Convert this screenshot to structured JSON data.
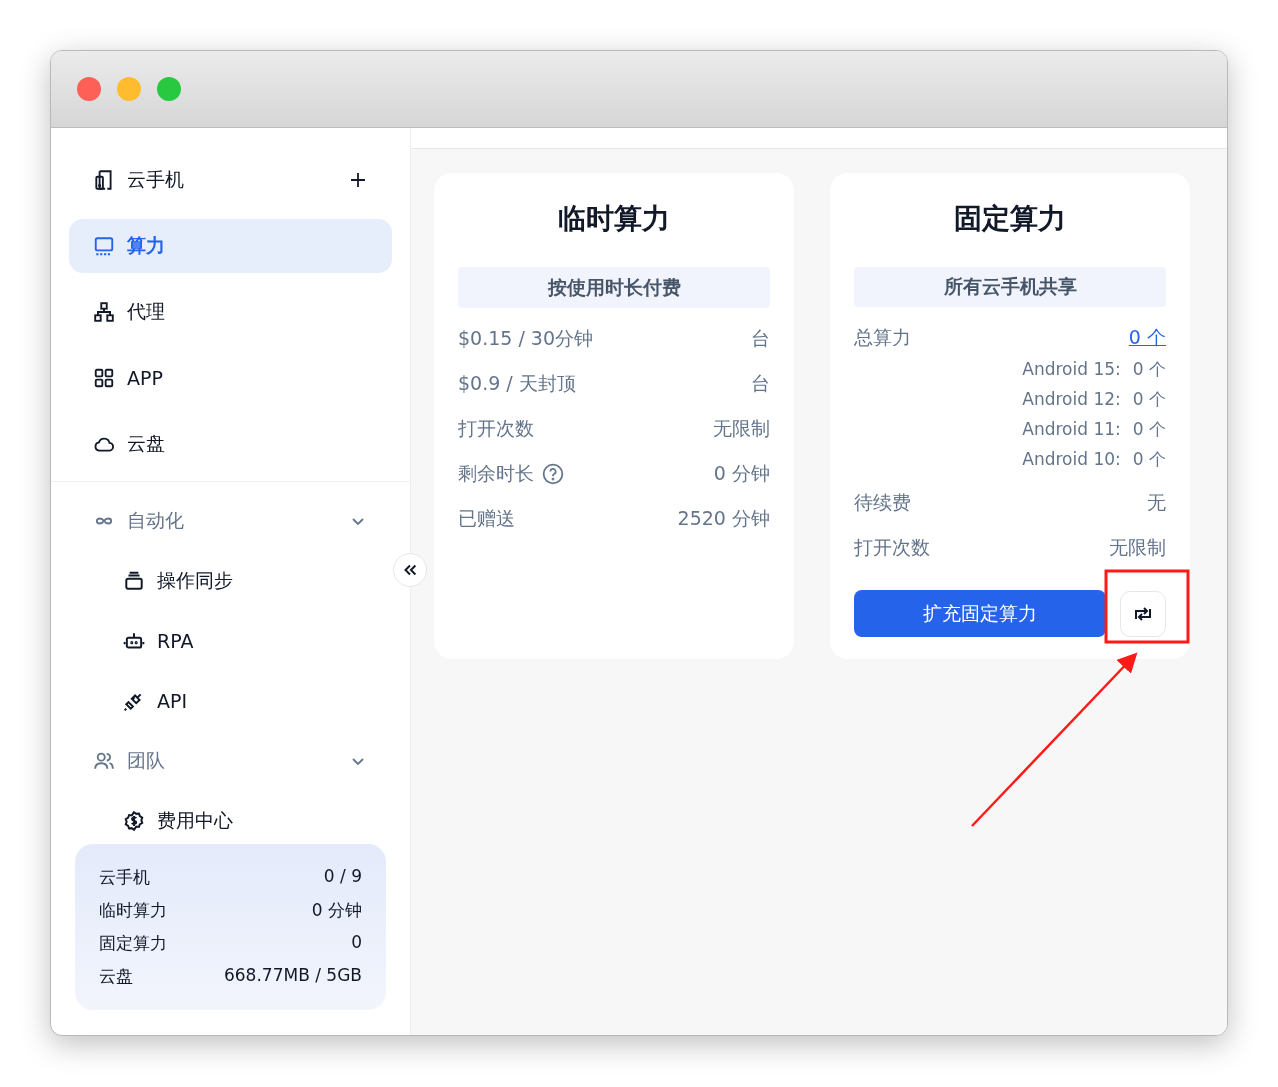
{
  "sidebar": {
    "items": [
      {
        "label": "云手机",
        "selected": false,
        "add_button": true
      },
      {
        "label": "算力",
        "selected": true,
        "add_button": false
      },
      {
        "label": "代理",
        "selected": false,
        "add_button": false
      },
      {
        "label": "APP",
        "selected": false,
        "add_button": false
      },
      {
        "label": "云盘",
        "selected": false,
        "add_button": false
      }
    ],
    "groups": [
      {
        "label": "自动化",
        "expanded": true,
        "children": [
          {
            "label": "操作同步",
            "selected": false
          },
          {
            "label": "RPA",
            "selected": false
          },
          {
            "label": "API",
            "selected": false
          }
        ]
      },
      {
        "label": "团队",
        "expanded": true,
        "children": [
          {
            "label": "费用中心",
            "selected": false
          }
        ]
      }
    ],
    "usage": [
      {
        "label": "云手机",
        "value": "0 / 9"
      },
      {
        "label": "临时算力",
        "value": "0 分钟"
      },
      {
        "label": "固定算力",
        "value": "0"
      },
      {
        "label": "云盘",
        "value": "668.77MB / 5GB"
      }
    ]
  },
  "cards": [
    {
      "title": "临时算力",
      "banner": "按使用时长付费",
      "rows": [
        {
          "kind": "row",
          "label": "$0.15 / 30分钟",
          "value": "台",
          "help": false
        },
        {
          "kind": "row",
          "label": "$0.9 / 天封顶",
          "value": "台",
          "help": false
        },
        {
          "kind": "row",
          "label": "打开次数",
          "value": "无限制",
          "help": false
        },
        {
          "kind": "row",
          "label": "剩余时长",
          "value": "0 分钟",
          "help": true
        },
        {
          "kind": "row",
          "label": "已赠送",
          "value": "2520 分钟",
          "help": false
        }
      ]
    },
    {
      "title": "固定算力",
      "banner": "所有云手机共享",
      "rows": [
        {
          "kind": "link_row",
          "label": "总算力",
          "value": "0 个",
          "help": false
        },
        {
          "kind": "sub_row",
          "label": "Android 15:",
          "value": "0 个"
        },
        {
          "kind": "sub_row",
          "label": "Android 12:",
          "value": "0 个"
        },
        {
          "kind": "sub_row",
          "label": "Android 11:",
          "value": "0 个"
        },
        {
          "kind": "sub_row",
          "label": "Android 10:",
          "value": "0 个"
        },
        {
          "kind": "row",
          "label": "待续费",
          "value": "无",
          "help": false
        },
        {
          "kind": "row",
          "label": "打开次数",
          "value": "无限制",
          "help": false
        }
      ],
      "button": "扩充固定算力",
      "refresh_button": true
    }
  ],
  "annotation": {
    "highlight_box": true,
    "arrow": true
  }
}
